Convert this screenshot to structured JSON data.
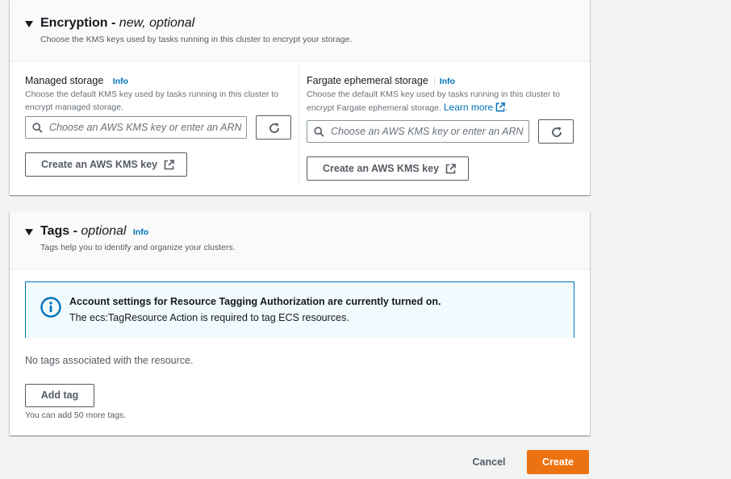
{
  "encryption": {
    "title": "Encryption -",
    "title_suffix": "new, optional",
    "description": "Choose the KMS keys used by tasks running in this cluster to encrypt your storage.",
    "managed": {
      "label": "Managed storage",
      "info": "Info",
      "description": "Choose the default KMS key used by tasks running in this cluster to encrypt managed storage.",
      "placeholder": "Choose an AWS KMS key or enter an ARN",
      "create_key_label": "Create an AWS KMS key"
    },
    "fargate": {
      "label": "Fargate ephemeral storage",
      "info": "Info",
      "description": "Choose the default KMS key used by tasks running in this cluster to encrypt Fargate ephemeral storage.",
      "learn_more": "Learn more",
      "placeholder": "Choose an AWS KMS key or enter an ARN",
      "create_key_label": "Create an AWS KMS key"
    }
  },
  "tags": {
    "title": "Tags -",
    "title_suffix": "optional",
    "info": "Info",
    "description": "Tags help you to identify and organize your clusters.",
    "alert": {
      "title": "Account settings for Resource Tagging Authorization are currently turned on.",
      "body": "The ecs:TagResource Action is required to tag ECS resources."
    },
    "empty_text": "No tags associated with the resource.",
    "add_tag_label": "Add tag",
    "limit_text": "You can add 50 more tags."
  },
  "footer": {
    "cancel_label": "Cancel",
    "create_label": "Create"
  },
  "colors": {
    "accent": "#0073bb",
    "primary_button": "#ec7211",
    "background": "#f2f3f3"
  }
}
